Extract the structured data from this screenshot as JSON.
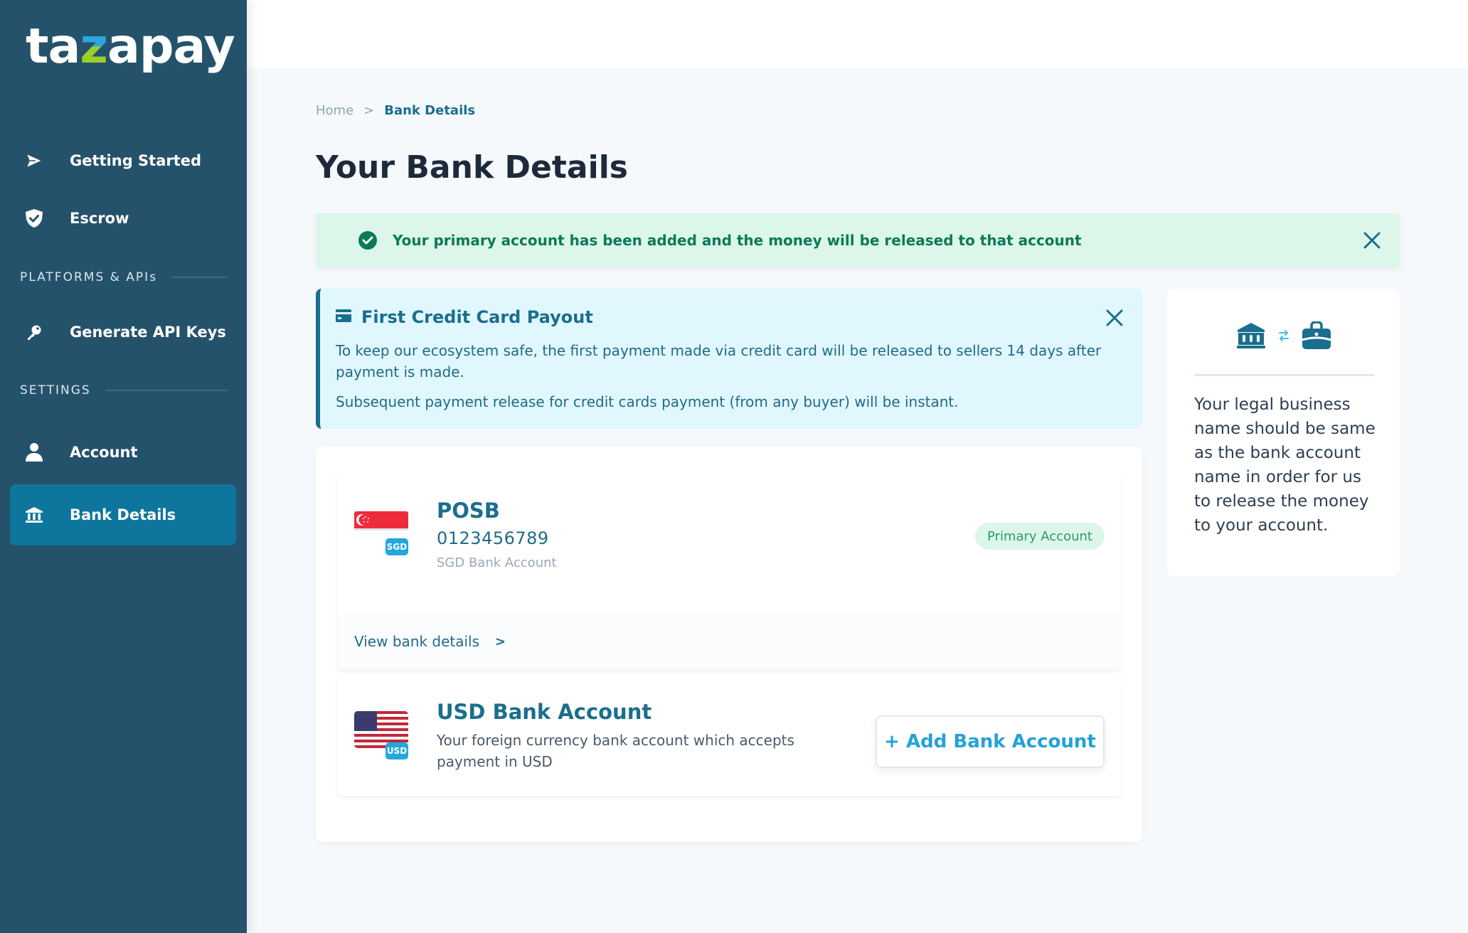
{
  "brand": {
    "logo_prefix": "ta",
    "logo_z": "z",
    "logo_suffix": "apay"
  },
  "sidebar": {
    "items": [
      {
        "label": "Getting Started",
        "icon": "paper-plane-icon"
      },
      {
        "label": "Escrow",
        "icon": "shield-check-icon"
      },
      {
        "label": "Generate API Keys",
        "icon": "key-icon"
      },
      {
        "label": "Account",
        "icon": "user-icon"
      },
      {
        "label": "Bank Details",
        "icon": "bank-icon",
        "active": true
      }
    ],
    "sections": {
      "platforms": "PLATFORMS & APIs",
      "settings": "SETTINGS"
    }
  },
  "breadcrumb": {
    "home": "Home",
    "separator": ">",
    "current": "Bank Details"
  },
  "page": {
    "title": "Your Bank Details"
  },
  "success_banner": {
    "message": "Your primary account has been added and the money will be released to that account"
  },
  "info_box": {
    "title": "First Credit Card Payout",
    "para1": "To keep our ecosystem safe, the first payment made via credit card will be released to sellers 14 days after payment is made.",
    "para2": "Subsequent payment release for credit cards payment (from any buyer) will be instant."
  },
  "side_card": {
    "note": "Your legal business name should be same as the bank account name in order for us to release the money to your account."
  },
  "accounts": {
    "primary": {
      "bank_name": "POSB",
      "account_number": "0123456789",
      "account_type": "SGD Bank Account",
      "currency": "SGD",
      "badge": "Primary Account",
      "view_link": "View bank details",
      "view_chevron": ">"
    },
    "usd": {
      "title": "USD Bank Account",
      "description": "Your foreign currency bank account which accepts payment in USD",
      "currency": "USD",
      "add_button": "+ Add Bank Account"
    }
  },
  "colors": {
    "sidebar_bg": "#25526b",
    "active_item": "#0e769c",
    "primary_text": "#1a6e8e",
    "success": "#0b7a58",
    "accent": "#23a2d8"
  }
}
